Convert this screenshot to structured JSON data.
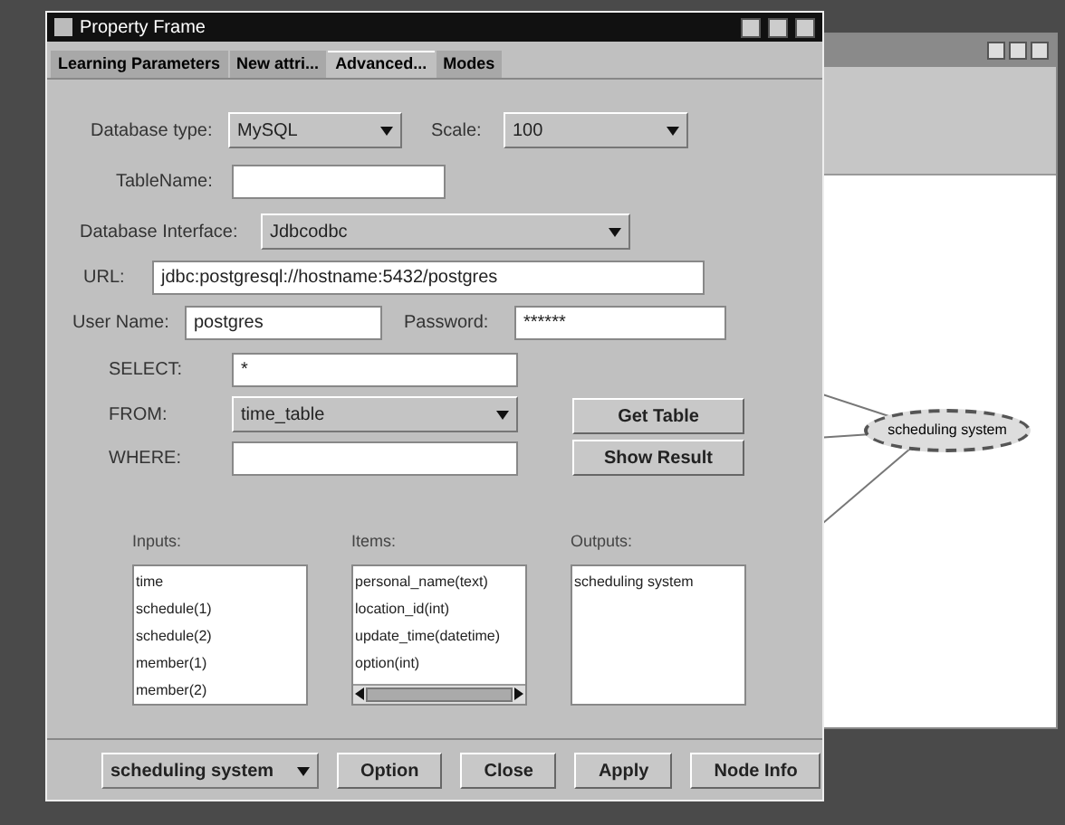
{
  "background_window": {
    "node_label": "scheduling system"
  },
  "dialog": {
    "title": "Property Frame"
  },
  "tabs": [
    {
      "label": "Learning Parameters",
      "selected": false
    },
    {
      "label": "New attri...",
      "selected": false
    },
    {
      "label": "Advanced...",
      "selected": true
    },
    {
      "label": "Modes",
      "selected": false
    }
  ],
  "form": {
    "database_type": {
      "label": "Database type:",
      "value": "MySQL"
    },
    "scale": {
      "label": "Scale:",
      "value": "100"
    },
    "table_name": {
      "label": "TableName:"
    },
    "database_interface": {
      "label": "Database Interface:",
      "value": "Jdbcodbc"
    },
    "url": {
      "label": "URL:",
      "value": "jdbc:postgresql://hostname:5432/postgres"
    },
    "user_name": {
      "label": "User Name:",
      "value": "postgres"
    },
    "password": {
      "label": "Password:",
      "value": "******"
    },
    "select": {
      "label": "SELECT:",
      "value": "*"
    },
    "from": {
      "label": "FROM:",
      "value": "time_table"
    },
    "where": {
      "label": "WHERE:"
    }
  },
  "buttons": [
    "Get Table",
    "Show Result"
  ],
  "lists": [
    {
      "label": "Inputs:",
      "items": [
        "time",
        "schedule(1)",
        "schedule(2)",
        "member(1)",
        "member(2)"
      ],
      "scrollbar": false
    },
    {
      "label": "Items:",
      "items": [
        "personal_name(text)",
        "location_id(int)",
        "update_time(datetime)",
        "option(int)"
      ],
      "scrollbar": true
    },
    {
      "label": "Outputs:",
      "items": [
        "scheduling system"
      ],
      "scrollbar": false
    }
  ],
  "footer": {
    "node": "scheduling system",
    "buttons": [
      "Option",
      "Close",
      "Apply",
      "Node Info"
    ]
  }
}
